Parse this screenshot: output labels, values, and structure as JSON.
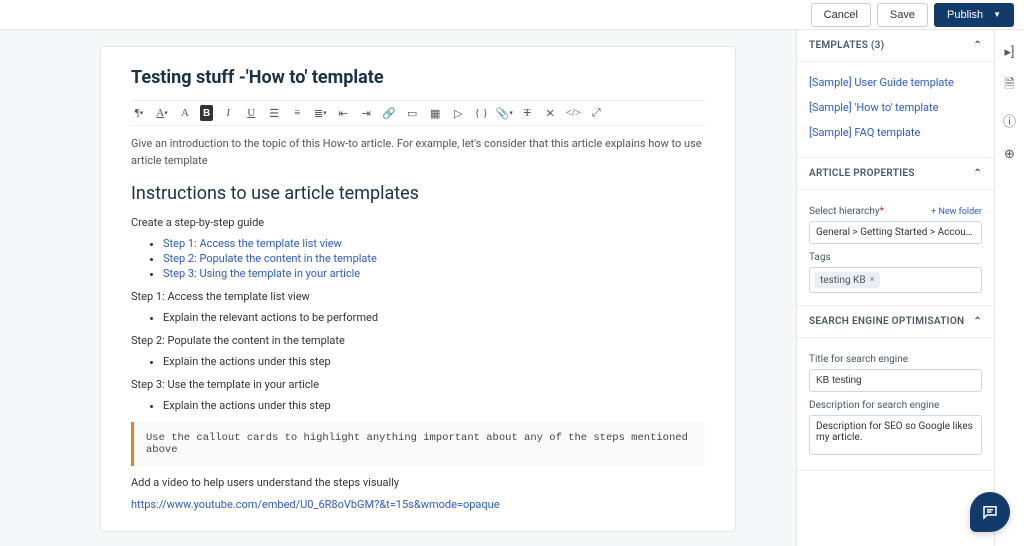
{
  "header": {
    "cancel": "Cancel",
    "save": "Save",
    "publish": "Publish"
  },
  "article": {
    "title": "Testing stuff -'How to' template",
    "intro": "Give an introduction to the topic of this How-to article. For example, let's consider that this article explains how to use article template",
    "heading": "Instructions to use article templates",
    "guide_label": "Create a step-by-step guide",
    "steps_links": [
      "Step 1: Access the template list view",
      "Step 2: Populate the content in the template",
      "Step 3: Using the template in your article"
    ],
    "step1_title": "Step 1: Access the template list view",
    "step1_item": "Explain the relevant actions to be performed",
    "step2_title": "Step 2: Populate the content in the template",
    "step2_item": "Explain the actions under this step",
    "step3_title": "Step 3: Use the template in your article",
    "step3_item": "Explain the actions under this step",
    "callout": "Use the callout cards to highlight anything important about any of the steps mentioned above",
    "video_hint": "Add a video to help users understand the steps visually",
    "video_url": "https://www.youtube.com/embed/U0_6R8oVbGM?&t=15s&wmode=opaque"
  },
  "sidebar": {
    "templates": {
      "header": "TEMPLATES (3)",
      "items": [
        "[Sample] User Guide template",
        "[Sample] 'How to' template",
        "[Sample] FAQ template"
      ]
    },
    "properties": {
      "header": "ARTICLE PROPERTIES",
      "hierarchy_label": "Select hierarchy",
      "new_folder": "+ New folder",
      "hierarchy_value": "General > Getting Started > Account Sett",
      "tags_label": "Tags",
      "tag_value": "testing KB"
    },
    "seo": {
      "header": "SEARCH ENGINE OPTIMISATION",
      "title_label": "Title for search engine",
      "title_value": "KB testing",
      "desc_label": "Description for search engine",
      "desc_value": "Description for SEO so Google likes my article."
    }
  }
}
